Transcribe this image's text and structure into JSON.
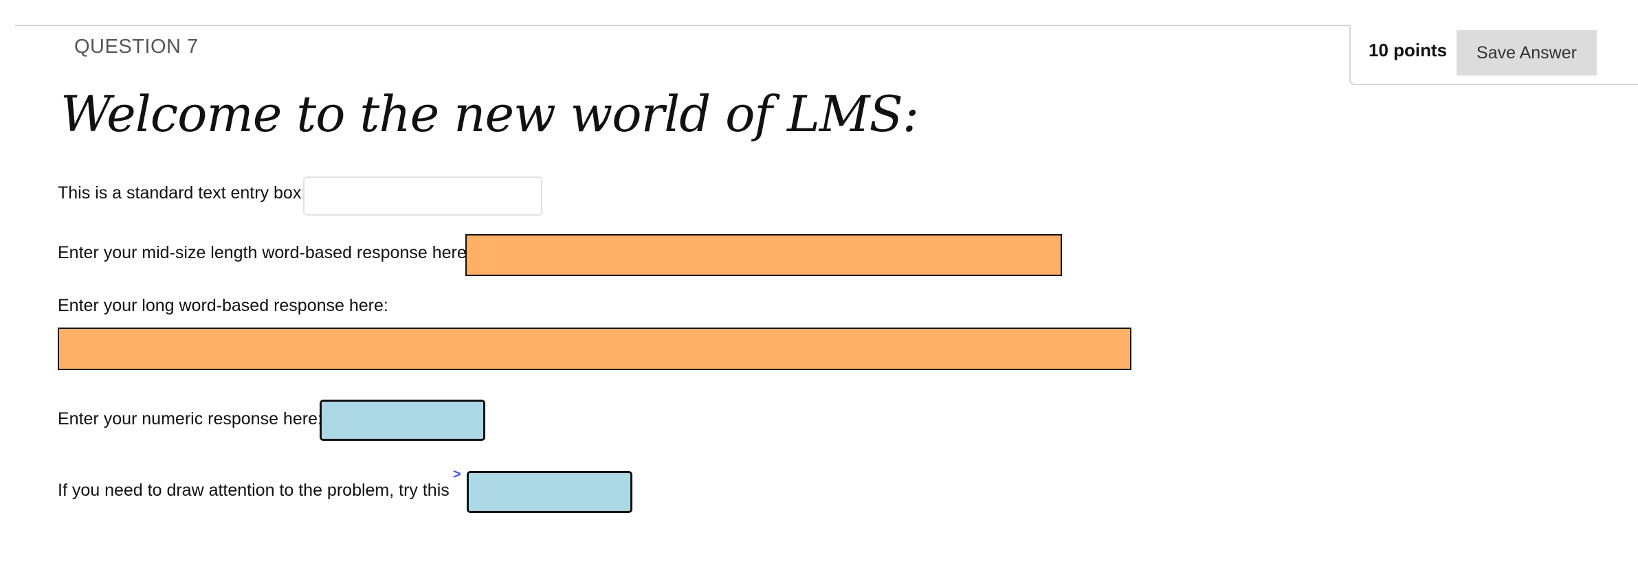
{
  "question": {
    "label": "QUESTION 7",
    "points": "10 points",
    "save_label": "Save Answer"
  },
  "heading": "Welcome to the new world of LMS:",
  "fields": {
    "standard": {
      "label": "This is a standard text entry box:",
      "value": ""
    },
    "midsize": {
      "label": "Enter your mid-size length word-based response here:",
      "value": ""
    },
    "long": {
      "label": "Enter your long word-based response here:",
      "value": ""
    },
    "numeric": {
      "label": "Enter your numeric response here:",
      "value": ""
    },
    "attention": {
      "label": "If you need to draw attention to the problem, try this",
      "marker": ">",
      "value": ""
    }
  },
  "colors": {
    "orange_field": "#ffb067",
    "blue_field": "#add8e6",
    "save_button_bg": "#dcdcdc",
    "marker": "#3d55ff"
  }
}
